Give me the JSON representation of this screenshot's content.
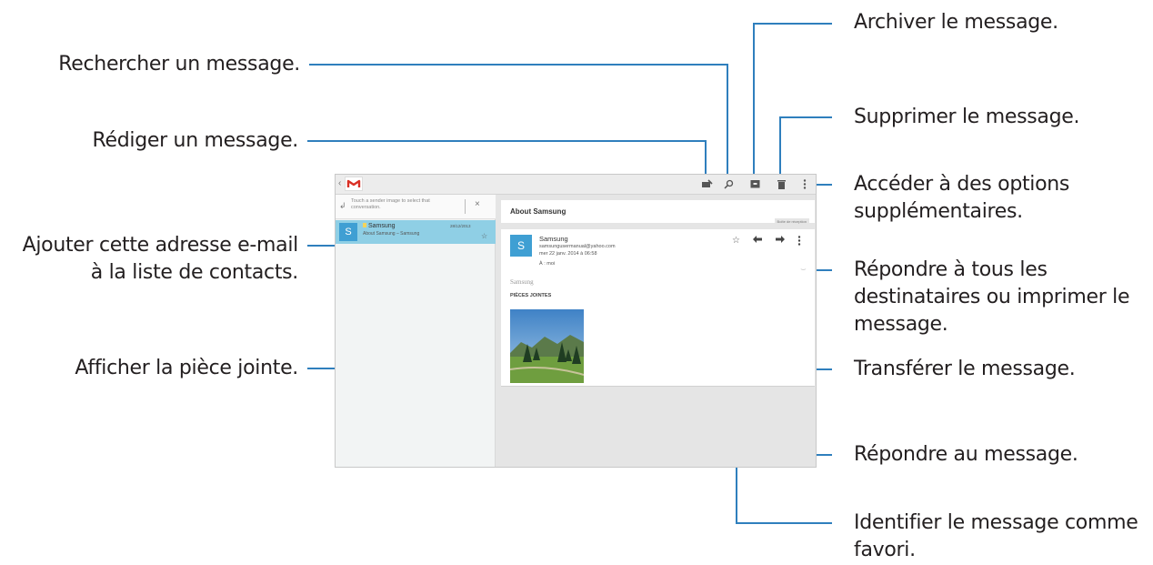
{
  "callouts": {
    "archive": "Archiver le message.",
    "search": "Rechercher un message.",
    "delete": "Supprimer le message.",
    "compose": "Rédiger un message.",
    "more_options_line1": "Accéder à des options",
    "more_options_line2": "supplémentaires.",
    "add_contact_line1": "Ajouter cette adresse e-mail",
    "add_contact_line2": "à la liste de contacts.",
    "reply_all_line1": "Répondre à tous les",
    "reply_all_line2": "destinataires ou imprimer le",
    "reply_all_line3": "message.",
    "view_attachment": "Afficher la pièce jointe.",
    "forward": "Transférer le message.",
    "reply": "Répondre au message.",
    "favorite_line1": "Identifier le message comme",
    "favorite_line2": "favori."
  },
  "screen": {
    "hint": "Touch a sender image to select that conversation.",
    "conversation": {
      "avatar_letter": "S",
      "sender": "Samsung",
      "subject": "About Samsung – Samsung",
      "date": "28/12/2013"
    },
    "message": {
      "subject": "About Samsung",
      "label": "Boîte de réception",
      "avatar_letter": "S",
      "sender_name": "Samsung",
      "sender_email": "samsungusermanual@yahoo.com",
      "date": "mer 22 janv. 2014 à 06:58",
      "to": "À : moi",
      "body": "Samsung",
      "attachments_title": "PIÈCES JOINTES"
    },
    "icons": [
      "back-chevron-icon",
      "gmail-icon",
      "compose-icon",
      "search-icon",
      "archive-icon",
      "trash-icon",
      "overflow-icon",
      "star-icon",
      "reply-icon",
      "forward-icon"
    ],
    "colors": {
      "selection": "#8fcfe5",
      "avatar": "#3f9fd3",
      "leader_line": "#2f7fbd"
    }
  }
}
